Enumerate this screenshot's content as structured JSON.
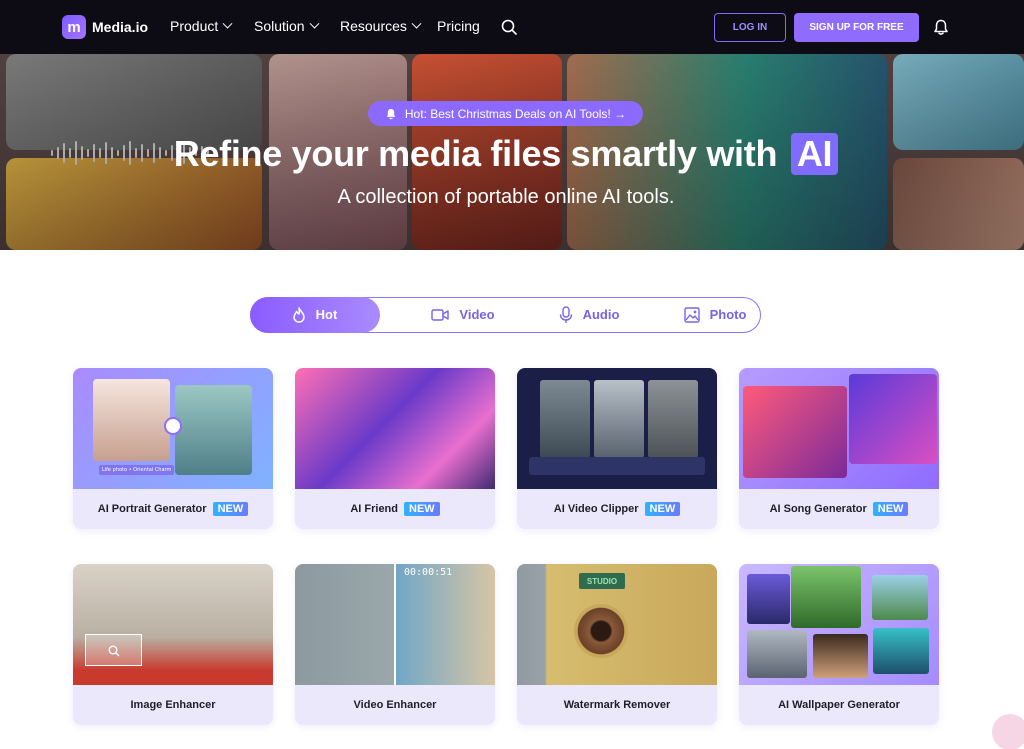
{
  "nav": {
    "logo": "Media.io",
    "items": [
      {
        "label": "Product",
        "dropdown": true
      },
      {
        "label": "Solution",
        "dropdown": true
      },
      {
        "label": "Resources",
        "dropdown": true
      },
      {
        "label": "Pricing",
        "dropdown": false
      }
    ],
    "login": "LOG IN",
    "signup": "SIGN UP FOR FREE"
  },
  "hero": {
    "promo": "Hot: Best Christmas Deals on AI Tools! →",
    "title": "Refine your media files smartly with",
    "title_badge": "AI",
    "subtitle": "A collection of portable online AI tools."
  },
  "tabs": [
    {
      "label": "Hot",
      "icon": "flame-icon",
      "active": true
    },
    {
      "label": "Video",
      "icon": "video-icon",
      "active": false
    },
    {
      "label": "Audio",
      "icon": "microphone-icon",
      "active": false
    },
    {
      "label": "Photo",
      "icon": "image-icon",
      "active": false
    }
  ],
  "cards": [
    {
      "title": "AI Portrait Generator",
      "badge": "NEW",
      "image_text": [
        "Life photo",
        "Oriental Charm"
      ]
    },
    {
      "title": "AI Friend",
      "badge": "NEW"
    },
    {
      "title": "AI Video Clipper",
      "badge": "NEW"
    },
    {
      "title": "AI Song Generator",
      "badge": "NEW"
    },
    {
      "title": "Image Enhancer",
      "badge": ""
    },
    {
      "title": "Video Enhancer",
      "badge": "",
      "timestamp": "00:00:51"
    },
    {
      "title": "Watermark Remover",
      "badge": "",
      "sign_text": "STUDIO"
    },
    {
      "title": "AI Wallpaper Generator",
      "badge": ""
    }
  ],
  "colors": {
    "brand": "#8f6cff",
    "nav_bg": "#0d0b14",
    "card_bg": "#ece8fb",
    "new_badge": "#2fb2ff"
  }
}
